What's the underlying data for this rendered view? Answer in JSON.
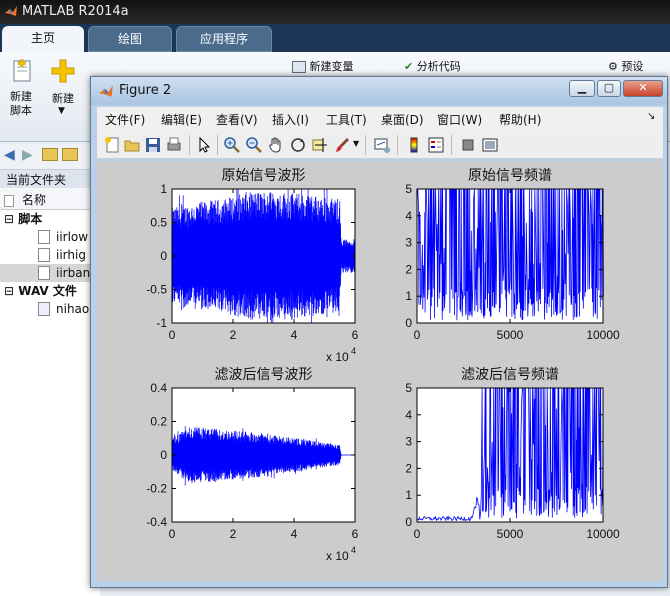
{
  "app": {
    "title": "MATLAB R2014a",
    "tabs": [
      {
        "label": "主页",
        "active": true
      },
      {
        "label": "绘图",
        "active": false
      },
      {
        "label": "应用程序",
        "active": false
      }
    ]
  },
  "ribbon": {
    "new_script_label": "新建\n脚本",
    "new_label": "新建",
    "new_variable_label": "新建变量",
    "analyze_code_label": "分析代码",
    "preferences_label": "预设"
  },
  "current_folder": {
    "title": "当前文件夹",
    "name_col": "名称",
    "groups": [
      {
        "label": "脚本",
        "files": [
          "iirlow",
          "iirhig",
          "iirban"
        ]
      },
      {
        "label": "WAV 文件",
        "files": [
          "nihao"
        ]
      }
    ],
    "selected": "iirban"
  },
  "figure": {
    "title": "Figure 2",
    "menus": [
      "文件(F)",
      "编辑(E)",
      "查看(V)",
      "插入(I)",
      "工具(T)",
      "桌面(D)",
      "窗口(W)",
      "帮助(H)"
    ],
    "trace_color": "#0000ff"
  },
  "chart_data": [
    {
      "type": "line",
      "title": "原始信号波形",
      "xlim": [
        0,
        60000
      ],
      "ylim": [
        -1,
        1
      ],
      "xticks": [
        "0",
        "2",
        "4",
        "6"
      ],
      "yticks": [
        "1",
        "0.5",
        "0",
        "-0.5",
        "-1"
      ],
      "x_exponent": "x 10",
      "x_exponent_power": "4",
      "series": [
        {
          "envelope": [
            [
              0,
              0.72
            ],
            [
              8000,
              0.8
            ],
            [
              16000,
              0.85
            ],
            [
              24000,
              0.95
            ],
            [
              32000,
              0.98
            ],
            [
              40000,
              0.95
            ],
            [
              48000,
              0.9
            ],
            [
              55000,
              0.85
            ],
            [
              55500,
              0.25
            ],
            [
              60000,
              0.25
            ]
          ]
        }
      ]
    },
    {
      "type": "line",
      "title": "原始信号频谱",
      "xlim": [
        0,
        10000
      ],
      "ylim": [
        0,
        5
      ],
      "xticks": [
        "0",
        "5000",
        "10000"
      ],
      "yticks": [
        "5",
        "4",
        "3",
        "2",
        "1",
        "0"
      ],
      "series": [
        {
          "description": "dense spectrum lines clipped at 5"
        }
      ]
    },
    {
      "type": "line",
      "title": "滤波后信号波形",
      "xlim": [
        0,
        60000
      ],
      "ylim": [
        -0.4,
        0.4
      ],
      "xticks": [
        "0",
        "2",
        "4",
        "6"
      ],
      "yticks": [
        "0.4",
        "0.2",
        "0",
        "-0.2",
        "-0.4"
      ],
      "x_exponent": "x 10",
      "x_exponent_power": "4",
      "series": [
        {
          "envelope": [
            [
              0,
              0.1
            ],
            [
              6000,
              0.17
            ],
            [
              12000,
              0.16
            ],
            [
              18000,
              0.15
            ],
            [
              24000,
              0.14
            ],
            [
              30000,
              0.13
            ],
            [
              36000,
              0.11
            ],
            [
              42000,
              0.1
            ],
            [
              48000,
              0.08
            ],
            [
              55000,
              0.06
            ],
            [
              55500,
              0.0
            ],
            [
              60000,
              0.0
            ]
          ]
        }
      ]
    },
    {
      "type": "line",
      "title": "滤波后信号频谱",
      "xlim": [
        0,
        10000
      ],
      "ylim": [
        0,
        5
      ],
      "xticks": [
        "0",
        "5000",
        "10000"
      ],
      "yticks": [
        "5",
        "4",
        "3",
        "2",
        "1",
        "0"
      ],
      "series": [
        {
          "passband_start": 3500,
          "description": "near zero below ~3500, dense lines clipped at 5 above"
        }
      ]
    }
  ]
}
